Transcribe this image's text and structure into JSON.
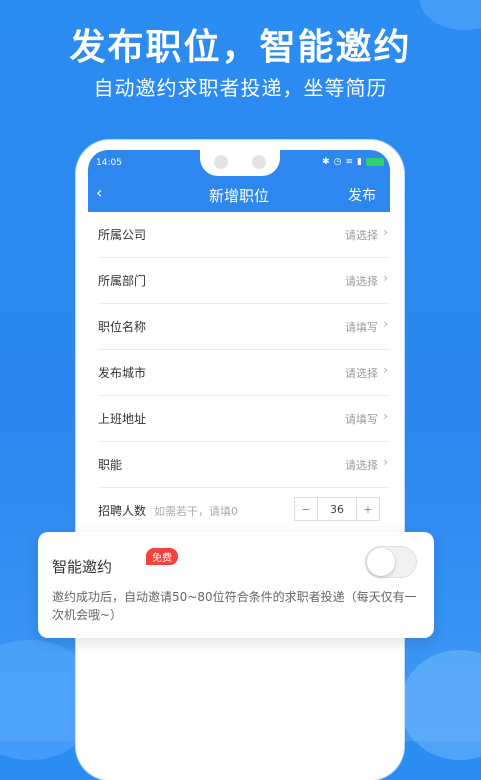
{
  "promo": {
    "headline": "发布职位，智能邀约",
    "subline": "自动邀约求职者投递，坐等简历"
  },
  "statusbar": {
    "time": "14:05",
    "icons": [
      "bluetooth-icon",
      "alarm-icon",
      "wifi-icon",
      "signal-icon",
      "battery-icon"
    ]
  },
  "navbar": {
    "back": "‹",
    "title": "新增职位",
    "publish_label": "发布"
  },
  "form": {
    "rows": [
      {
        "label": "所属公司",
        "value": "请选择"
      },
      {
        "label": "所属部门",
        "value": "请选择"
      },
      {
        "label": "职位名称",
        "value": "请填写"
      },
      {
        "label": "发布城市",
        "value": "请选择"
      },
      {
        "label": "上班地址",
        "value": "请填写"
      },
      {
        "label": "职能",
        "value": "请选择"
      }
    ],
    "hire": {
      "label": "招聘人数",
      "hint": "如需若干，请填0",
      "minus": "−",
      "count": "36",
      "plus": "+"
    }
  },
  "smart_invite": {
    "title": "智能邀约",
    "badge": "免费",
    "enabled": false,
    "description": "邀约成功后，自动邀请50~80位符合条件的求职者投递（每天仅有一次机会哦~）"
  },
  "colors": {
    "brand_blue": "#2d87ee",
    "badge_red": "#f5433b"
  }
}
